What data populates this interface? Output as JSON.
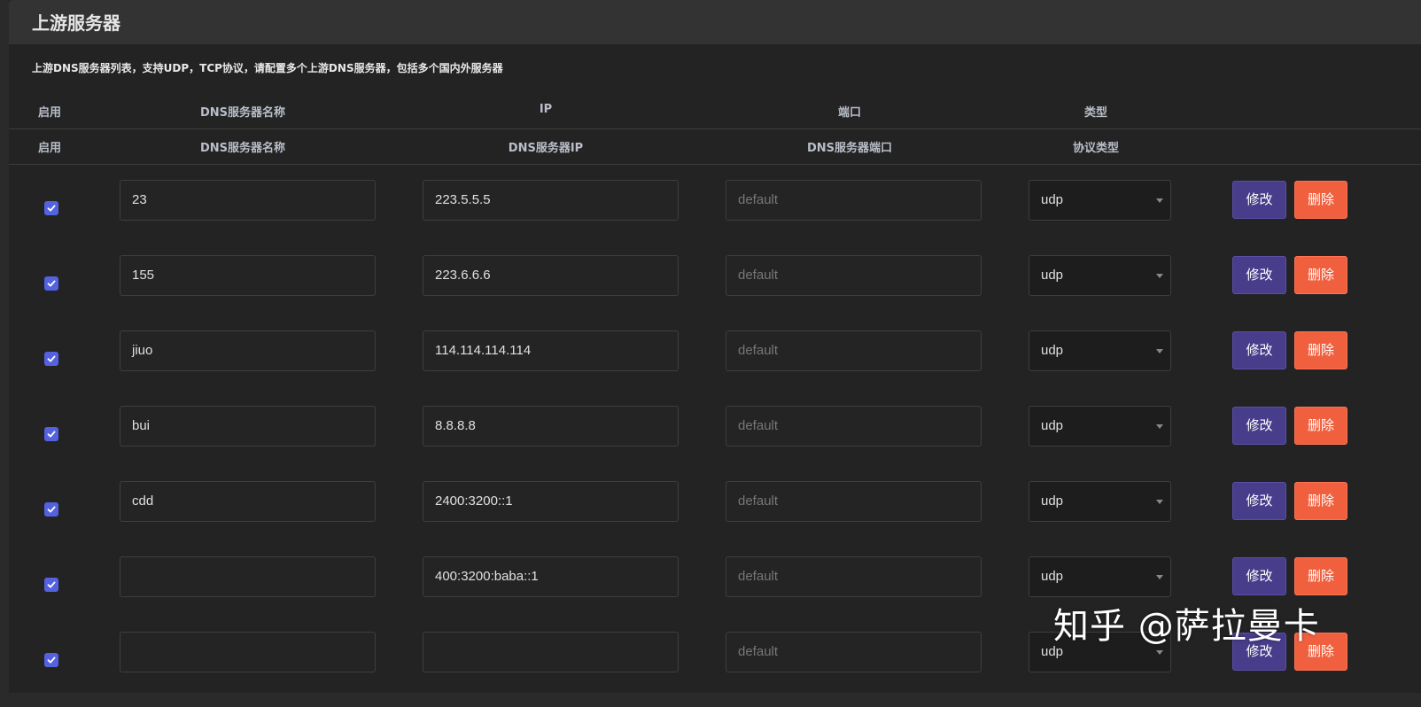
{
  "panel": {
    "title": "上游服务器",
    "description": "上游DNS服务器列表，支持UDP，TCP协议，请配置多个上游DNS服务器，包括多个国内外服务器"
  },
  "header1": {
    "enable": "启用",
    "name": "DNS服务器名称",
    "ip": "IP",
    "port": "端口",
    "type": "类型"
  },
  "header2": {
    "enable": "启用",
    "name": "DNS服务器名称",
    "ip": "DNS服务器IP",
    "port": "DNS服务器端口",
    "type": "协议类型"
  },
  "rows": [
    {
      "enabled": true,
      "name": "23",
      "ip": "223.5.5.5",
      "port_placeholder": "default",
      "type": "udp",
      "edit": "修改",
      "delete": "删除"
    },
    {
      "enabled": true,
      "name": "155",
      "ip": "223.6.6.6",
      "port_placeholder": "default",
      "type": "udp",
      "edit": "修改",
      "delete": "删除"
    },
    {
      "enabled": true,
      "name": "jiuo",
      "ip": "114.114.114.114",
      "port_placeholder": "default",
      "type": "udp",
      "edit": "修改",
      "delete": "删除"
    },
    {
      "enabled": true,
      "name": "bui",
      "ip": "8.8.8.8",
      "port_placeholder": "default",
      "type": "udp",
      "edit": "修改",
      "delete": "删除"
    },
    {
      "enabled": true,
      "name": "cdd",
      "ip": "2400:3200::1",
      "port_placeholder": "default",
      "type": "udp",
      "edit": "修改",
      "delete": "删除"
    },
    {
      "enabled": true,
      "name": "",
      "ip": "400:3200:baba::1",
      "port_placeholder": "default",
      "type": "udp",
      "edit": "修改",
      "delete": "删除"
    },
    {
      "enabled": true,
      "name": "",
      "ip": "",
      "port_placeholder": "default",
      "type": "udp",
      "edit": "修改",
      "delete": "删除"
    }
  ],
  "watermark": "知乎 @萨拉曼卡",
  "colors": {
    "checkbox": "#5462e0",
    "edit_button": "#483d8b",
    "delete_button": "#f0603f"
  }
}
